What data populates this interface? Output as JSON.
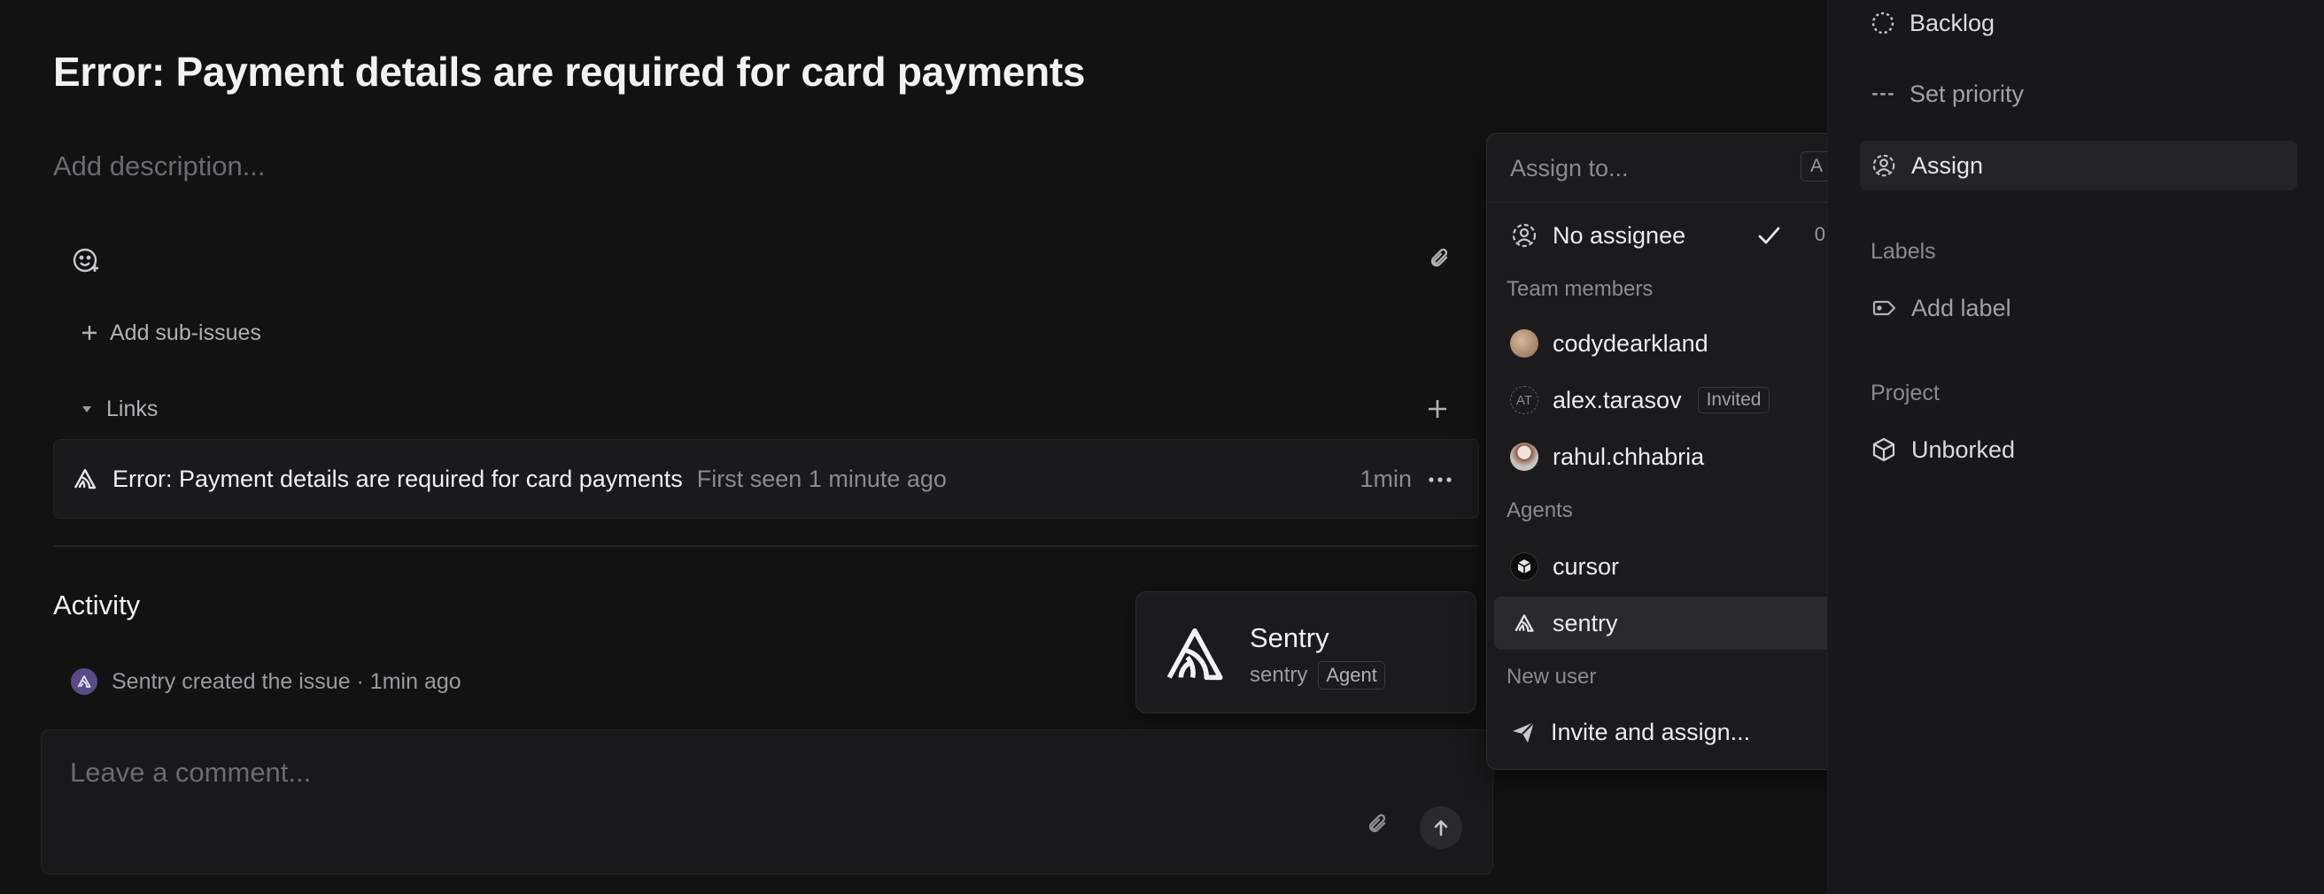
{
  "issue": {
    "title": "Error: Payment details are required for card payments",
    "description_placeholder": "Add description...",
    "add_subissues": "Add sub-issues",
    "links_label": "Links",
    "link": {
      "title": "Error: Payment details are required for card payments",
      "subtitle": "First seen 1 minute ago",
      "time": "1min"
    }
  },
  "activity": {
    "title": "Activity",
    "entry": "Sentry created the issue · 1min ago"
  },
  "comment": {
    "placeholder": "Leave a comment..."
  },
  "hovercard": {
    "name": "Sentry",
    "handle": "sentry",
    "badge": "Agent"
  },
  "assign_menu": {
    "search_placeholder": "Assign to...",
    "shortcut": "A",
    "no_assignee": {
      "label": "No assignee",
      "count": "0"
    },
    "team_members_label": "Team members",
    "team_members": [
      {
        "name": "codydearkland",
        "badge": ""
      },
      {
        "name": "alex.tarasov",
        "initials": "AT",
        "badge": "Invited"
      },
      {
        "name": "rahul.chhabria",
        "badge": ""
      }
    ],
    "agents_label": "Agents",
    "agents": [
      {
        "name": "cursor"
      },
      {
        "name": "sentry"
      }
    ],
    "new_user_label": "New user",
    "invite": "Invite and assign..."
  },
  "sidebar": {
    "status": "Backlog",
    "priority": "Set priority",
    "assign": "Assign",
    "labels_heading": "Labels",
    "add_label": "Add label",
    "project_heading": "Project",
    "project": "Unborked"
  }
}
